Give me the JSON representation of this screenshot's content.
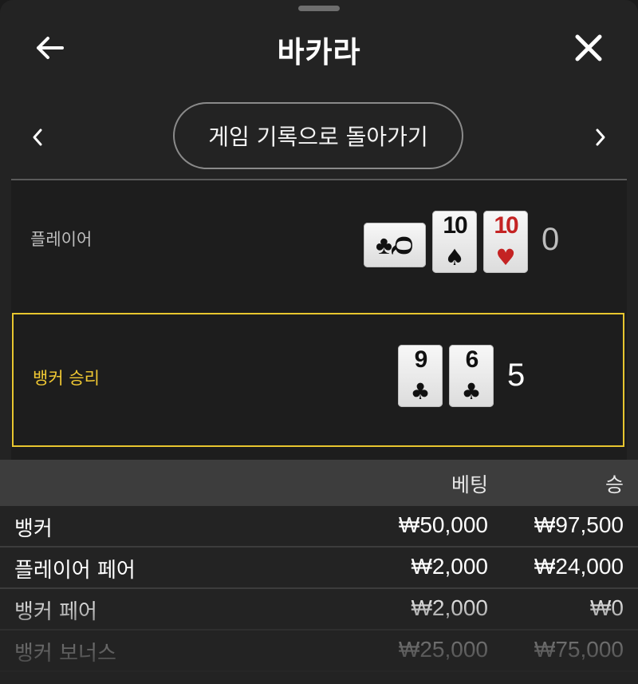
{
  "header": {
    "title": "바카라",
    "back_icon": "arrow-left-icon",
    "close_icon": "close-icon"
  },
  "nav": {
    "history_button": "게임 기록으로 돌아가기",
    "prev_icon": "chevron-left-icon",
    "next_icon": "chevron-right-icon"
  },
  "hands": {
    "player": {
      "label": "플레이어",
      "score": "0",
      "cards": [
        {
          "rank": "Q",
          "suit": "♣",
          "color": "black",
          "orientation": "sideways"
        },
        {
          "rank": "10",
          "suit": "♠",
          "color": "black",
          "orientation": "upright"
        },
        {
          "rank": "10",
          "suit": "♥",
          "color": "red",
          "orientation": "upright"
        }
      ]
    },
    "banker": {
      "label": "뱅커 승리",
      "score": "5",
      "cards": [
        {
          "rank": "9",
          "suit": "♣",
          "color": "black",
          "orientation": "upright"
        },
        {
          "rank": "6",
          "suit": "♣",
          "color": "black",
          "orientation": "upright"
        }
      ]
    }
  },
  "bets_table": {
    "columns": [
      "베팅",
      "승"
    ],
    "rows": [
      {
        "name": "뱅커",
        "bet": "₩50,000",
        "win": "₩97,500"
      },
      {
        "name": "플레이어 페어",
        "bet": "₩2,000",
        "win": "₩24,000"
      },
      {
        "name": "뱅커 페어",
        "bet": "₩2,000",
        "win": "₩0"
      },
      {
        "name": "뱅커 보너스",
        "bet": "₩25,000",
        "win": "₩75,000"
      }
    ]
  },
  "colors": {
    "accent": "#e8c62f",
    "background": "#232323",
    "hand_area": "#1d1d1d",
    "table_header": "#3d3d3d",
    "red_suit": "#c42323"
  }
}
